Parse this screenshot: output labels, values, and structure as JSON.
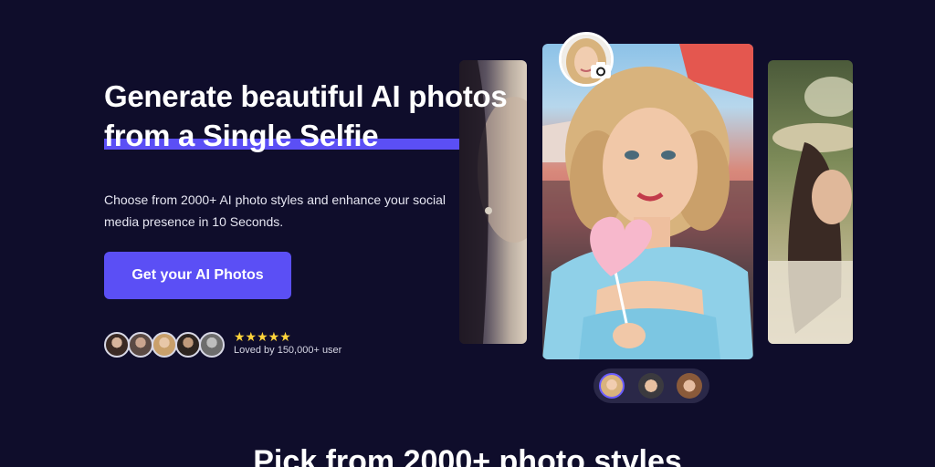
{
  "hero": {
    "headline_line1": "Generate beautiful AI photos",
    "headline_line2": "from a Single Selfie",
    "subtitle": "Choose from 2000+ AI photo styles and enhance your social media presence in 10 Seconds.",
    "cta_label": "Get your AI Photos"
  },
  "social_proof": {
    "stars": "★★★★★",
    "loved_text": "Loved by 150,000+ user"
  },
  "section": {
    "title": "Pick from 2000+ photo styles"
  },
  "colors": {
    "background": "#0f0d2b",
    "accent": "#5b4ff5",
    "star": "#ffd43b"
  }
}
